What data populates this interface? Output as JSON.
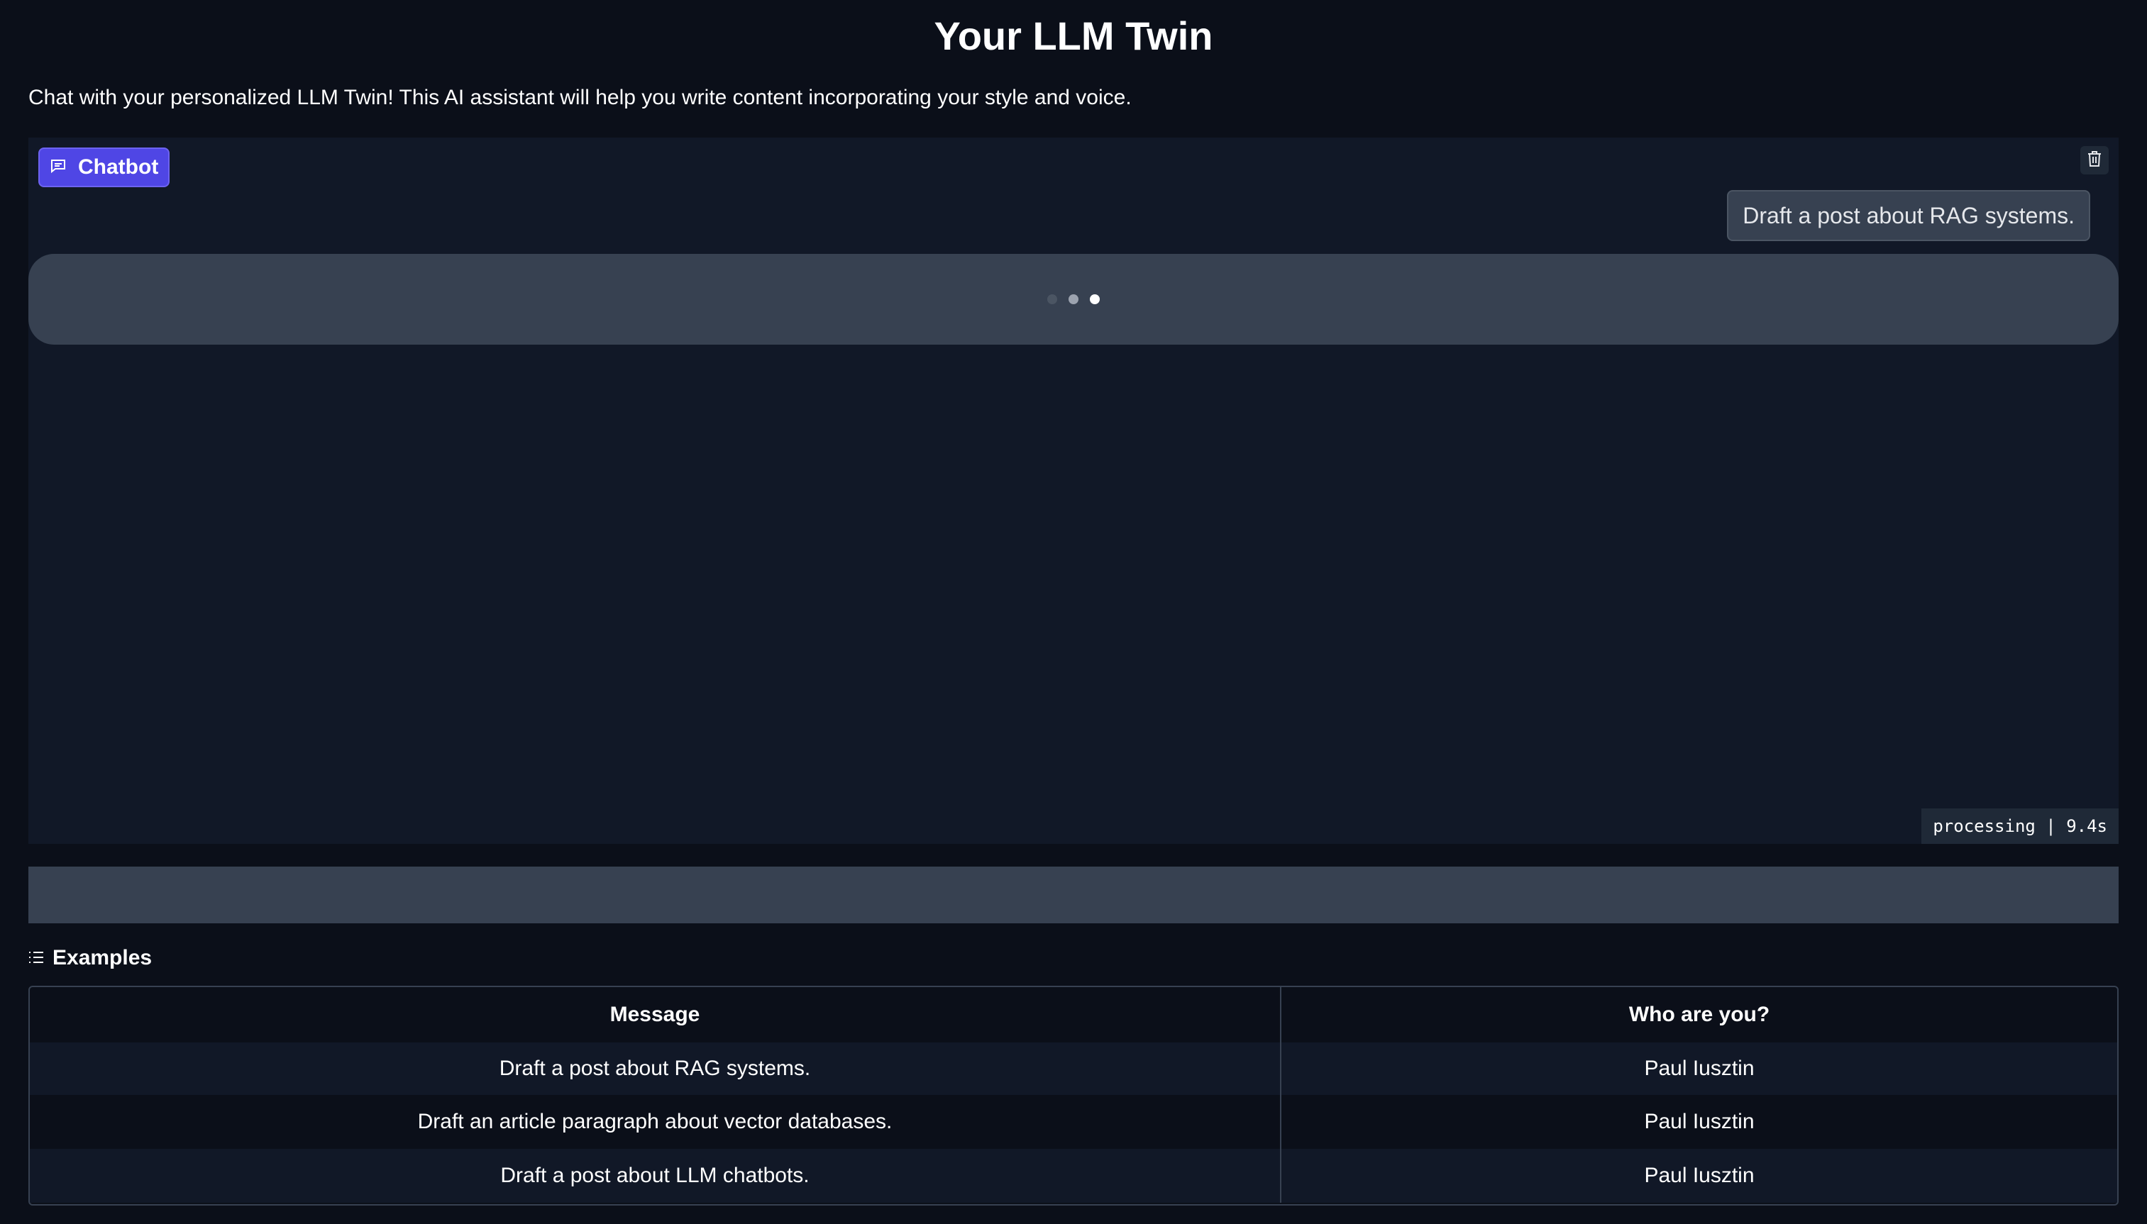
{
  "page": {
    "title": "Your LLM Twin",
    "description": "Chat with your personalized LLM Twin! This AI assistant will help you write content incorporating your style and voice."
  },
  "chatbot": {
    "label": "Chatbot",
    "messages": [
      {
        "role": "user",
        "text": "Draft a post about RAG systems."
      }
    ],
    "bot_pending": true,
    "status": "processing | 9.4s"
  },
  "input": {
    "value": "",
    "placeholder": ""
  },
  "examples": {
    "heading": "Examples",
    "columns": [
      "Message",
      "Who are you?"
    ],
    "rows": [
      [
        "Draft a post about RAG systems.",
        "Paul Iusztin"
      ],
      [
        "Draft an article paragraph about vector databases.",
        "Paul Iusztin"
      ],
      [
        "Draft a post about LLM chatbots.",
        "Paul Iusztin"
      ]
    ]
  },
  "colors": {
    "background": "#0b0f19",
    "panel": "#111827",
    "accent": "#4f46e5",
    "bubble": "#374151"
  },
  "icons": {
    "chat_label": "chat-bubble-icon",
    "clear": "trash-icon",
    "examples": "list-icon"
  }
}
